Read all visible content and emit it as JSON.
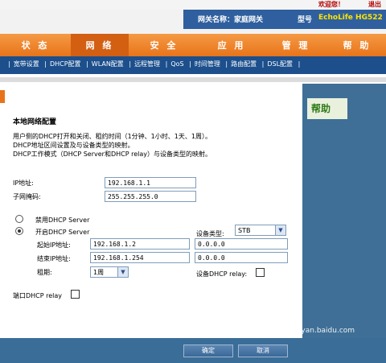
{
  "header": {
    "welcome": "欢迎您！",
    "logout": "退出",
    "gateway_label": "网关名称：家庭网关",
    "model_label": "型号",
    "model_value": "EchoLife HG522"
  },
  "nav": {
    "items": [
      "状 态",
      "网 络",
      "安 全",
      "应 用",
      "管 理",
      "帮 助"
    ],
    "active": "网 络"
  },
  "subnav": [
    "宽带设置",
    "DHCP配置",
    "WLAN配置",
    "远程管理",
    "QoS",
    "时间管理",
    "路由配置",
    "DSL配置"
  ],
  "help": {
    "title": "帮助"
  },
  "content": {
    "section_title": "本地网络配置",
    "desc1": "用户侧的DHCP打开和关闭、租约时间（1分钟、1小时、1天、1周）。",
    "desc2": "DHCP地址区间设置及与设备类型的映射。",
    "desc3": "DHCP工作模式（DHCP Server和DHCP relay）与设备类型的映射。",
    "ip_label": "IP地址:",
    "ip_value": "192.168.1.1",
    "mask_label": "子网掩码:",
    "mask_value": "255.255.255.0",
    "disable_dhcp": "禁用DHCP Server",
    "enable_dhcp": "开启DHCP Server",
    "device_type_label": "设备类型:",
    "device_type_value": "STB",
    "start_ip_label": "起始IP地址:",
    "start_ip_value": "192.168.1.2",
    "start_ip_device": "0.0.0.0",
    "end_ip_label": "结束IP地址:",
    "end_ip_value": "192.168.1.254",
    "end_ip_device": "0.0.0.0",
    "lease_label": "租期:",
    "lease_value": "1周",
    "device_relay_label": "设备DHCP relay:",
    "port_relay_label": "端口DHCP relay"
  },
  "footer": {
    "ok": "确定",
    "cancel": "取消"
  },
  "watermark": "jingyan.baidu.com"
}
